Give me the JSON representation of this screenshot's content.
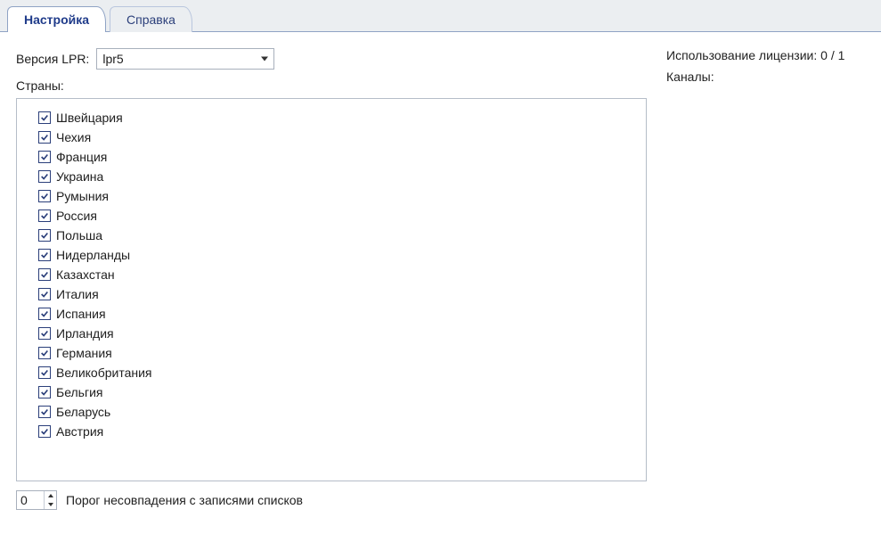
{
  "tabs": {
    "settings": "Настройка",
    "help": "Справка"
  },
  "version": {
    "label": "Версия LPR:",
    "value": "lpr5"
  },
  "countries_label": "Страны:",
  "countries": [
    {
      "name": "Швейцария",
      "checked": true
    },
    {
      "name": "Чехия",
      "checked": true
    },
    {
      "name": "Франция",
      "checked": true
    },
    {
      "name": "Украина",
      "checked": true
    },
    {
      "name": "Румыния",
      "checked": true
    },
    {
      "name": "Россия",
      "checked": true
    },
    {
      "name": "Польша",
      "checked": true
    },
    {
      "name": "Нидерланды",
      "checked": true
    },
    {
      "name": "Казахстан",
      "checked": true
    },
    {
      "name": "Италия",
      "checked": true
    },
    {
      "name": "Испания",
      "checked": true
    },
    {
      "name": "Ирландия",
      "checked": true
    },
    {
      "name": "Германия",
      "checked": true
    },
    {
      "name": "Великобритания",
      "checked": true
    },
    {
      "name": "Бельгия",
      "checked": true
    },
    {
      "name": "Беларусь",
      "checked": true
    },
    {
      "name": "Австрия",
      "checked": true
    }
  ],
  "threshold": {
    "value": "0",
    "label": "Порог несовпадения с записями списков"
  },
  "right": {
    "license_usage_label": "Использование лицензии:",
    "license_usage_value": "0 / 1",
    "channels_label": "Каналы:"
  }
}
